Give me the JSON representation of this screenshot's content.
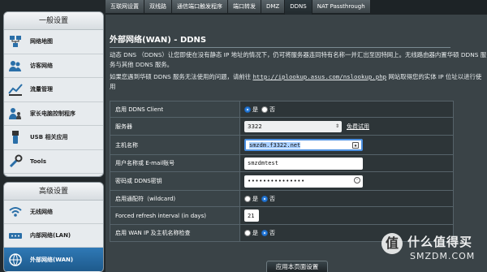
{
  "sidebar": {
    "general_title": "一般设置",
    "general_items": [
      {
        "label": "网络地图",
        "icon": "network-map-icon"
      },
      {
        "label": "访客网络",
        "icon": "guest-network-icon"
      },
      {
        "label": "流量管理",
        "icon": "traffic-manager-icon"
      },
      {
        "label": "家长电脑控制程序",
        "icon": "parental-control-icon"
      },
      {
        "label": "USB 相关应用",
        "icon": "usb-icon"
      },
      {
        "label": "Tools",
        "icon": "tools-icon"
      }
    ],
    "advanced_title": "高级设置",
    "advanced_items": [
      {
        "label": "无线网络",
        "icon": "wireless-icon"
      },
      {
        "label": "内部网络(LAN)",
        "icon": "lan-icon"
      },
      {
        "label": "外部网络(WAN)",
        "icon": "wan-icon"
      }
    ]
  },
  "tabs": [
    "互联网设置",
    "双线路",
    "通信端口触发程序",
    "端口转发",
    "DMZ",
    "DDNS",
    "NAT Passthrough"
  ],
  "active_tab": "DDNS",
  "main": {
    "title": "外部网络(WAN) - DDNS",
    "desc1": "动态 DNS （DDNS）让您即使在没有静态 IP 地址的情况下，仍可将服务器连同特有名称一并汇出至因特网上。无线路由器内置华硕 DDNS 服务与其他 DDNS 服务。",
    "desc2_prefix": "如果您遇到华硕 DDNS 服务无法使用的问题，请前往 ",
    "desc2_url": "http://iplookup.asus.com/nslookup.php",
    "desc2_suffix": " 网站取得您的实体 IP 位址以进行使用",
    "rows": {
      "enable_label": "启用 DDNS Client",
      "server_label": "服务器",
      "server_value": "3322",
      "server_link": "免费试用",
      "host_label": "主机名称",
      "host_value": "smzdm.f3322.net",
      "user_label": "用户名称或 E-mail账号",
      "user_value": "smzdmtest",
      "pass_label": "密码或 DDNS密钥",
      "pass_value": "•••••••••••••••",
      "wild_label": "启用通配符（wildcard)",
      "forced_label": "Forced refresh interval (in days)",
      "forced_value": "21",
      "wanip_label": "启用 WAN IP 及主机名称检查",
      "yes": "是",
      "no": "否"
    },
    "apply_label": "应用本页面设置"
  },
  "watermark": {
    "badge": "值",
    "text": "什么值得买",
    "domain": "SMZDM.COM"
  },
  "colors": {
    "accent": "#2f79b6",
    "panel": "#3a4347",
    "focus": "#4b8fe0"
  }
}
